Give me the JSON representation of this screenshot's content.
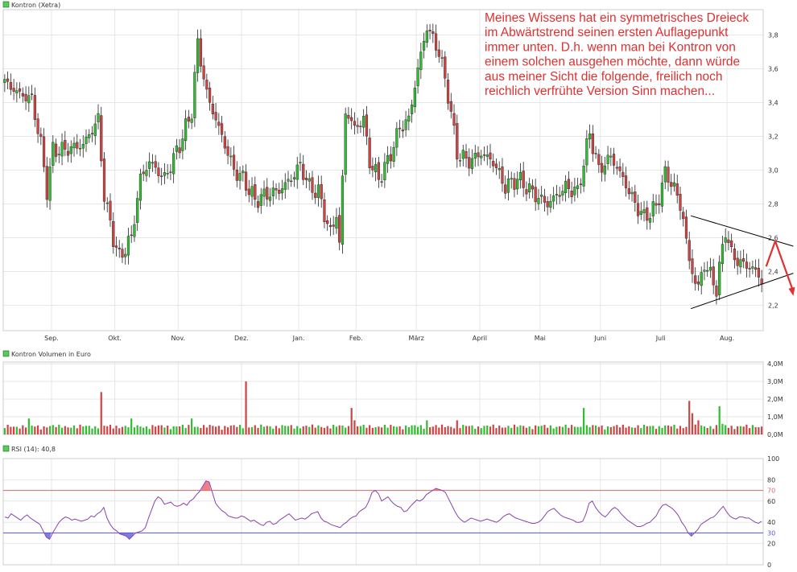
{
  "colors": {
    "up": "#33bb33",
    "down": "#cc4444",
    "grid": "#e6e6e6",
    "frame": "#cccccc",
    "rsi_line": "#8844aa",
    "rsi_upper": "#dd6666",
    "rsi_lower": "#5555cc",
    "annotation": "#e03030",
    "trendline": "#000000"
  },
  "chart_data": [
    {
      "type": "candlestick",
      "legend": "Kontron (Xetra)",
      "ylim": [
        2.05,
        3.95
      ],
      "yticks": [
        "2,2",
        "2,4",
        "2,6",
        "2,8",
        "3,0",
        "3,2",
        "3,4",
        "3,6",
        "3,8"
      ],
      "x_months": [
        {
          "label": "Sep.",
          "index": 16
        },
        {
          "label": "Okt.",
          "index": 37
        },
        {
          "label": "Nov.",
          "index": 58
        },
        {
          "label": "Dez.",
          "index": 79
        },
        {
          "label": "Jan.",
          "index": 98
        },
        {
          "label": "Feb.",
          "index": 117
        },
        {
          "label": "März",
          "index": 137
        },
        {
          "label": "April",
          "index": 158
        },
        {
          "label": "Mai",
          "index": 178
        },
        {
          "label": "Juni",
          "index": 198
        },
        {
          "label": "Juli",
          "index": 218
        },
        {
          "label": "Aug.",
          "index": 240
        }
      ],
      "anchors": [
        [
          0,
          3.52
        ],
        [
          5,
          3.45
        ],
        [
          9,
          3.42
        ],
        [
          12,
          3.15
        ],
        [
          14,
          2.88
        ],
        [
          16,
          3.12
        ],
        [
          20,
          3.12
        ],
        [
          26,
          3.15
        ],
        [
          31,
          3.3
        ],
        [
          33,
          2.85
        ],
        [
          36,
          2.6
        ],
        [
          38,
          2.48
        ],
        [
          42,
          2.6
        ],
        [
          45,
          2.95
        ],
        [
          48,
          3.05
        ],
        [
          53,
          2.95
        ],
        [
          58,
          3.15
        ],
        [
          62,
          3.35
        ],
        [
          64,
          3.75
        ],
        [
          67,
          3.45
        ],
        [
          71,
          3.25
        ],
        [
          76,
          3.0
        ],
        [
          79,
          2.95
        ],
        [
          83,
          2.82
        ],
        [
          86,
          2.85
        ],
        [
          91,
          2.88
        ],
        [
          95,
          2.95
        ],
        [
          98,
          3.03
        ],
        [
          101,
          2.9
        ],
        [
          104,
          2.87
        ],
        [
          108,
          2.62
        ],
        [
          110,
          2.75
        ],
        [
          111,
          2.55
        ],
        [
          113,
          3.35
        ],
        [
          116,
          3.25
        ],
        [
          119,
          3.3
        ],
        [
          121,
          3.05
        ],
        [
          124,
          2.95
        ],
        [
          127,
          3.05
        ],
        [
          131,
          3.25
        ],
        [
          134,
          3.3
        ],
        [
          137,
          3.6
        ],
        [
          140,
          3.85
        ],
        [
          144,
          3.7
        ],
        [
          147,
          3.45
        ],
        [
          150,
          3.1
        ],
        [
          154,
          3.05
        ],
        [
          158,
          3.1
        ],
        [
          162,
          3.05
        ],
        [
          166,
          2.9
        ],
        [
          170,
          2.95
        ],
        [
          176,
          2.85
        ],
        [
          180,
          2.8
        ],
        [
          186,
          2.9
        ],
        [
          190,
          2.87
        ],
        [
          194,
          3.22
        ],
        [
          197,
          3.0
        ],
        [
          201,
          3.08
        ],
        [
          205,
          2.95
        ],
        [
          209,
          2.8
        ],
        [
          212,
          2.72
        ],
        [
          216,
          2.78
        ],
        [
          219,
          2.98
        ],
        [
          222,
          2.9
        ],
        [
          225,
          2.72
        ],
        [
          227,
          2.45
        ],
        [
          230,
          2.3
        ],
        [
          232,
          2.45
        ],
        [
          236,
          2.3
        ],
        [
          239,
          2.65
        ],
        [
          241,
          2.5
        ],
        [
          244,
          2.45
        ],
        [
          248,
          2.42
        ],
        [
          251,
          2.35
        ]
      ],
      "candles": 252,
      "annotation": [
        "Meines Wissens hat ein symmetrisches Dreieck",
        "im Abwärtstrend seinen ersten Auflagepunkt",
        "immer unten. D.h. wenn man bei Kontron von",
        "einem solchen ausgehen möchte, dann würde",
        "aus meiner Sicht die folgende, freilich noch",
        "reichlich verfrühte Version Sinn machen..."
      ],
      "triangle_upper": [
        [
          228,
          2.73
        ],
        [
          262,
          2.55
        ]
      ],
      "triangle_lower": [
        [
          228,
          2.18
        ],
        [
          262,
          2.39
        ]
      ],
      "projection": [
        [
          253,
          2.43
        ],
        [
          256,
          2.58
        ],
        [
          262,
          2.28
        ]
      ]
    },
    {
      "type": "bar",
      "legend": "Kontron Volumen in Euro",
      "ylim": [
        0,
        4.1
      ],
      "yticks": [
        "0,0M",
        "1,0M",
        "2,0M",
        "3,0M",
        "4,0M"
      ],
      "base_value": 0.45,
      "spikes": [
        {
          "index": 8,
          "value": 0.9
        },
        {
          "index": 32,
          "value": 2.4
        },
        {
          "index": 42,
          "value": 0.9
        },
        {
          "index": 62,
          "value": 0.9
        },
        {
          "index": 80,
          "value": 3.0
        },
        {
          "index": 115,
          "value": 1.5
        },
        {
          "index": 116,
          "value": 0.8
        },
        {
          "index": 140,
          "value": 0.8
        },
        {
          "index": 150,
          "value": 0.8
        },
        {
          "index": 192,
          "value": 1.5
        },
        {
          "index": 227,
          "value": 1.9
        },
        {
          "index": 228,
          "value": 1.2
        },
        {
          "index": 230,
          "value": 0.8
        },
        {
          "index": 237,
          "value": 1.6
        },
        {
          "index": 238,
          "value": 0.6
        }
      ]
    },
    {
      "type": "line",
      "legend": "RSI (14): 40,8",
      "ylim": [
        0,
        100
      ],
      "yticks": [
        "0",
        "20",
        "30",
        "40",
        "60",
        "70",
        "80",
        "100"
      ],
      "upper": 70,
      "lower": 30,
      "values": [
        45,
        44,
        48,
        46,
        44,
        42,
        45,
        47,
        44,
        42,
        40,
        38,
        32,
        26,
        24,
        30,
        35,
        40,
        43,
        45,
        44,
        42,
        43,
        42,
        41,
        42,
        43,
        46,
        45,
        48,
        50,
        54,
        44,
        38,
        34,
        32,
        29,
        28,
        27,
        24,
        27,
        30,
        31,
        32,
        35,
        44,
        52,
        60,
        64,
        62,
        57,
        58,
        59,
        56,
        55,
        56,
        58,
        56,
        60,
        62,
        66,
        69,
        74,
        79,
        78,
        68,
        58,
        54,
        51,
        49,
        46,
        45,
        44,
        44,
        46,
        45,
        43,
        41,
        42,
        40,
        38,
        37,
        40,
        41,
        38,
        39,
        42,
        44,
        46,
        48,
        45,
        42,
        43,
        44,
        43,
        45,
        48,
        49,
        50,
        44,
        41,
        40,
        38,
        37,
        36,
        35,
        38,
        40,
        43,
        45,
        46,
        50,
        52,
        54,
        60,
        68,
        70,
        67,
        60,
        62,
        64,
        60,
        57,
        55,
        54,
        50,
        51,
        55,
        58,
        61,
        60,
        62,
        66,
        68,
        70,
        72,
        71,
        70,
        68,
        62,
        56,
        50,
        45,
        42,
        40,
        42,
        44,
        43,
        42,
        41,
        42,
        43,
        42,
        41,
        40,
        42,
        45,
        47,
        48,
        46,
        44,
        43,
        42,
        41,
        40,
        39,
        39,
        40,
        42,
        46,
        50,
        52,
        53,
        50,
        47,
        45,
        44,
        43,
        42,
        40,
        40,
        41,
        48,
        58,
        60,
        54,
        50,
        47,
        45,
        48,
        52,
        54,
        52,
        48,
        45,
        42,
        40,
        38,
        36,
        36,
        37,
        39,
        40,
        43,
        46,
        52,
        56,
        57,
        55,
        53,
        50,
        46,
        40,
        36,
        30,
        27,
        30,
        33,
        38,
        40,
        42,
        44,
        45,
        48,
        52,
        55,
        50,
        46,
        44,
        43,
        45,
        45,
        44,
        44,
        42,
        40,
        39,
        41
      ]
    }
  ]
}
